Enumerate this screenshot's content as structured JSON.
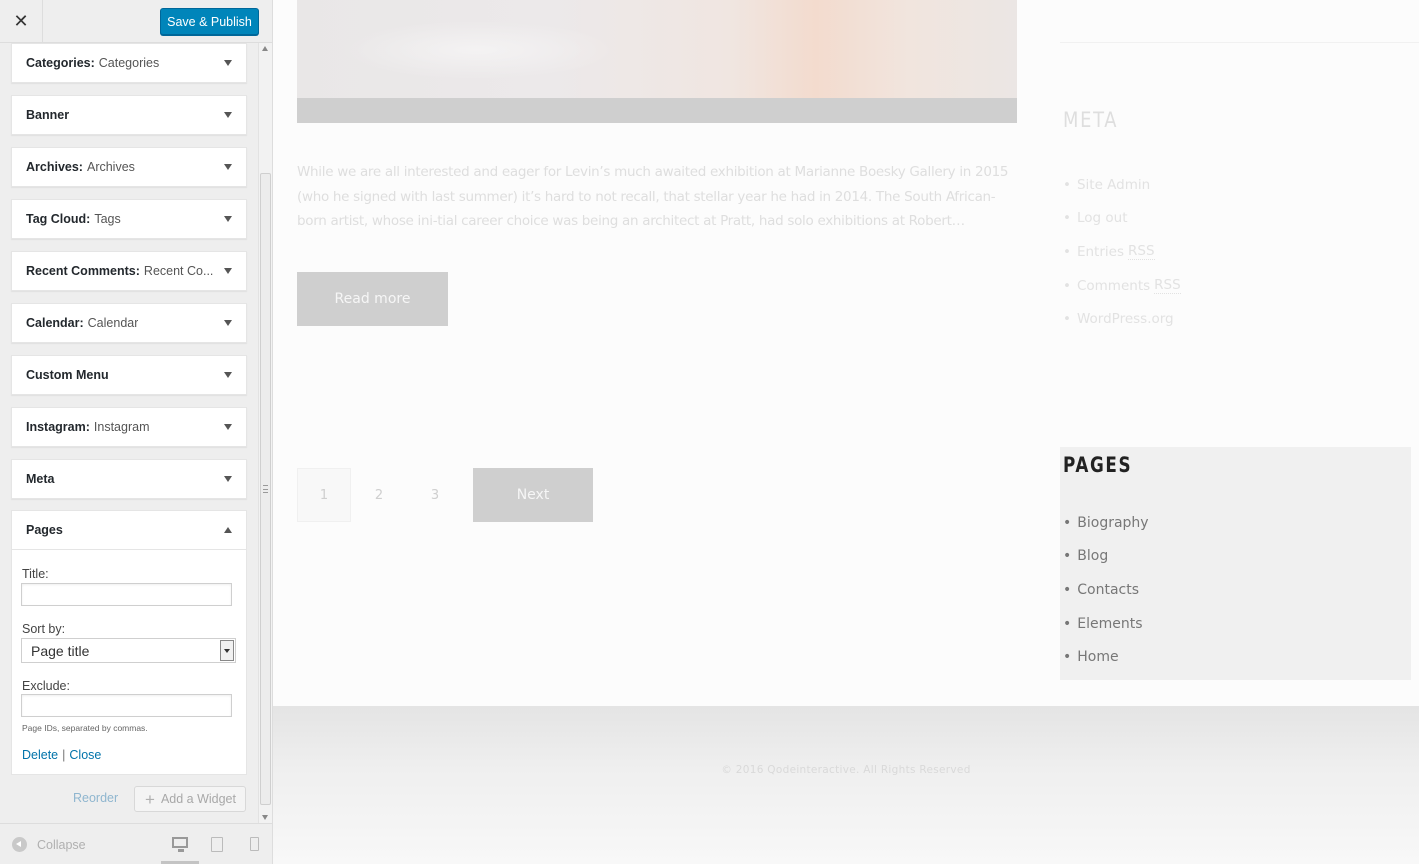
{
  "topbar": {
    "close_label": "✕",
    "publish_label": "Save & Publish"
  },
  "widgets": [
    {
      "name": "Categories:",
      "subtitle": "Categories"
    },
    {
      "name": "Banner",
      "subtitle": ""
    },
    {
      "name": "Archives:",
      "subtitle": "Archives"
    },
    {
      "name": "Tag Cloud:",
      "subtitle": "Tags"
    },
    {
      "name": "Recent Comments:",
      "subtitle": "Recent Co..."
    },
    {
      "name": "Calendar:",
      "subtitle": "Calendar"
    },
    {
      "name": "Custom Menu",
      "subtitle": ""
    },
    {
      "name": "Instagram:",
      "subtitle": "Instagram"
    },
    {
      "name": "Meta",
      "subtitle": ""
    }
  ],
  "pages_form": {
    "header": "Pages",
    "title_label": "Title:",
    "title_value": "",
    "sort_label": "Sort by:",
    "sort_value": "Page title",
    "exclude_label": "Exclude:",
    "exclude_value": "",
    "hint": "Page IDs, separated by commas.",
    "delete_label": "Delete",
    "separator": "|",
    "close_label": "Close"
  },
  "sidebar_footer": {
    "reorder_label": "Reorder",
    "add_widget_label": "Add a Widget",
    "collapse_label": "Collapse"
  },
  "preview": {
    "excerpt": "While we are all interested and eager for Levin’s much awaited exhibition at Marianne Boesky Gallery in 2015 (who he signed with last summer) it’s hard to not recall, that stellar year he had in 2014. The South African-born artist, whose ini-tial career choice was being an architect at Pratt, had solo exhibitions at Robert…",
    "read_more": "Read more",
    "pagination": [
      "1",
      "2",
      "3"
    ],
    "next_label": "Next",
    "meta_title": "META",
    "meta_items": [
      {
        "text": "Site Admin",
        "abbr": ""
      },
      {
        "text": "Log out",
        "abbr": ""
      },
      {
        "text": "Entries",
        "abbr": "RSS"
      },
      {
        "text": "Comments",
        "abbr": "RSS"
      },
      {
        "text": "WordPress.org",
        "abbr": ""
      }
    ],
    "pages_title": "PAGES",
    "pages_items": [
      "Biography",
      "Blog",
      "Contacts",
      "Elements",
      "Home"
    ],
    "copyright": "© 2016 Qodeinteractive. All Rights Reserved"
  },
  "colors": {
    "accent": "#0085ba",
    "link": "#0073aa"
  }
}
